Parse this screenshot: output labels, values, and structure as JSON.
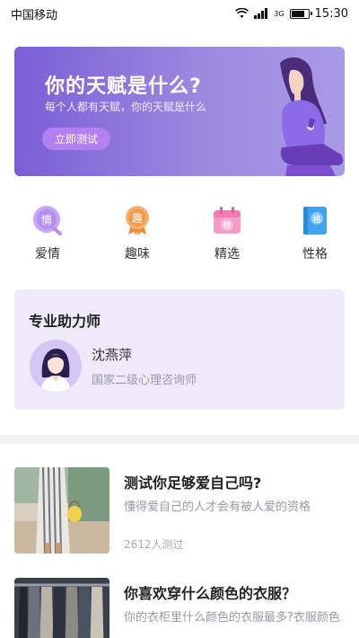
{
  "status_bar": {
    "carrier": "中国移动",
    "network": "3G",
    "time": "15:30"
  },
  "banner": {
    "title": "你的天赋是什么?",
    "subtitle": "每个人都有天赋，你的天赋是什么",
    "button": "立即测试"
  },
  "categories": [
    {
      "label": "爱情",
      "icon": "love-icon",
      "glyph": "情",
      "color": "#b48ef0"
    },
    {
      "label": "趣味",
      "icon": "fun-icon",
      "glyph": "趣",
      "color": "#f59a4a"
    },
    {
      "label": "精选",
      "icon": "featured-icon",
      "glyph": "精",
      "color": "#f27ab5"
    },
    {
      "label": "性格",
      "icon": "personality-icon",
      "glyph": "格",
      "color": "#3fa3ee"
    }
  ],
  "helper": {
    "title": "专业助力师",
    "name": "沈燕萍",
    "description": "国家二级心理咨询师"
  },
  "tests": [
    {
      "title": "测试你足够爱自己吗?",
      "description": "懂得爱自己的人才会有被人爱的资格",
      "count": "2612人测过"
    },
    {
      "title": "你喜欢穿什么颜色的衣服？",
      "description": "你的衣柜里什么颜色的衣服最多?衣服颜色"
    }
  ],
  "colors": {
    "accent": "#7b5ed6",
    "card_bg": "#efe9fc",
    "button": "#b47ff0"
  }
}
